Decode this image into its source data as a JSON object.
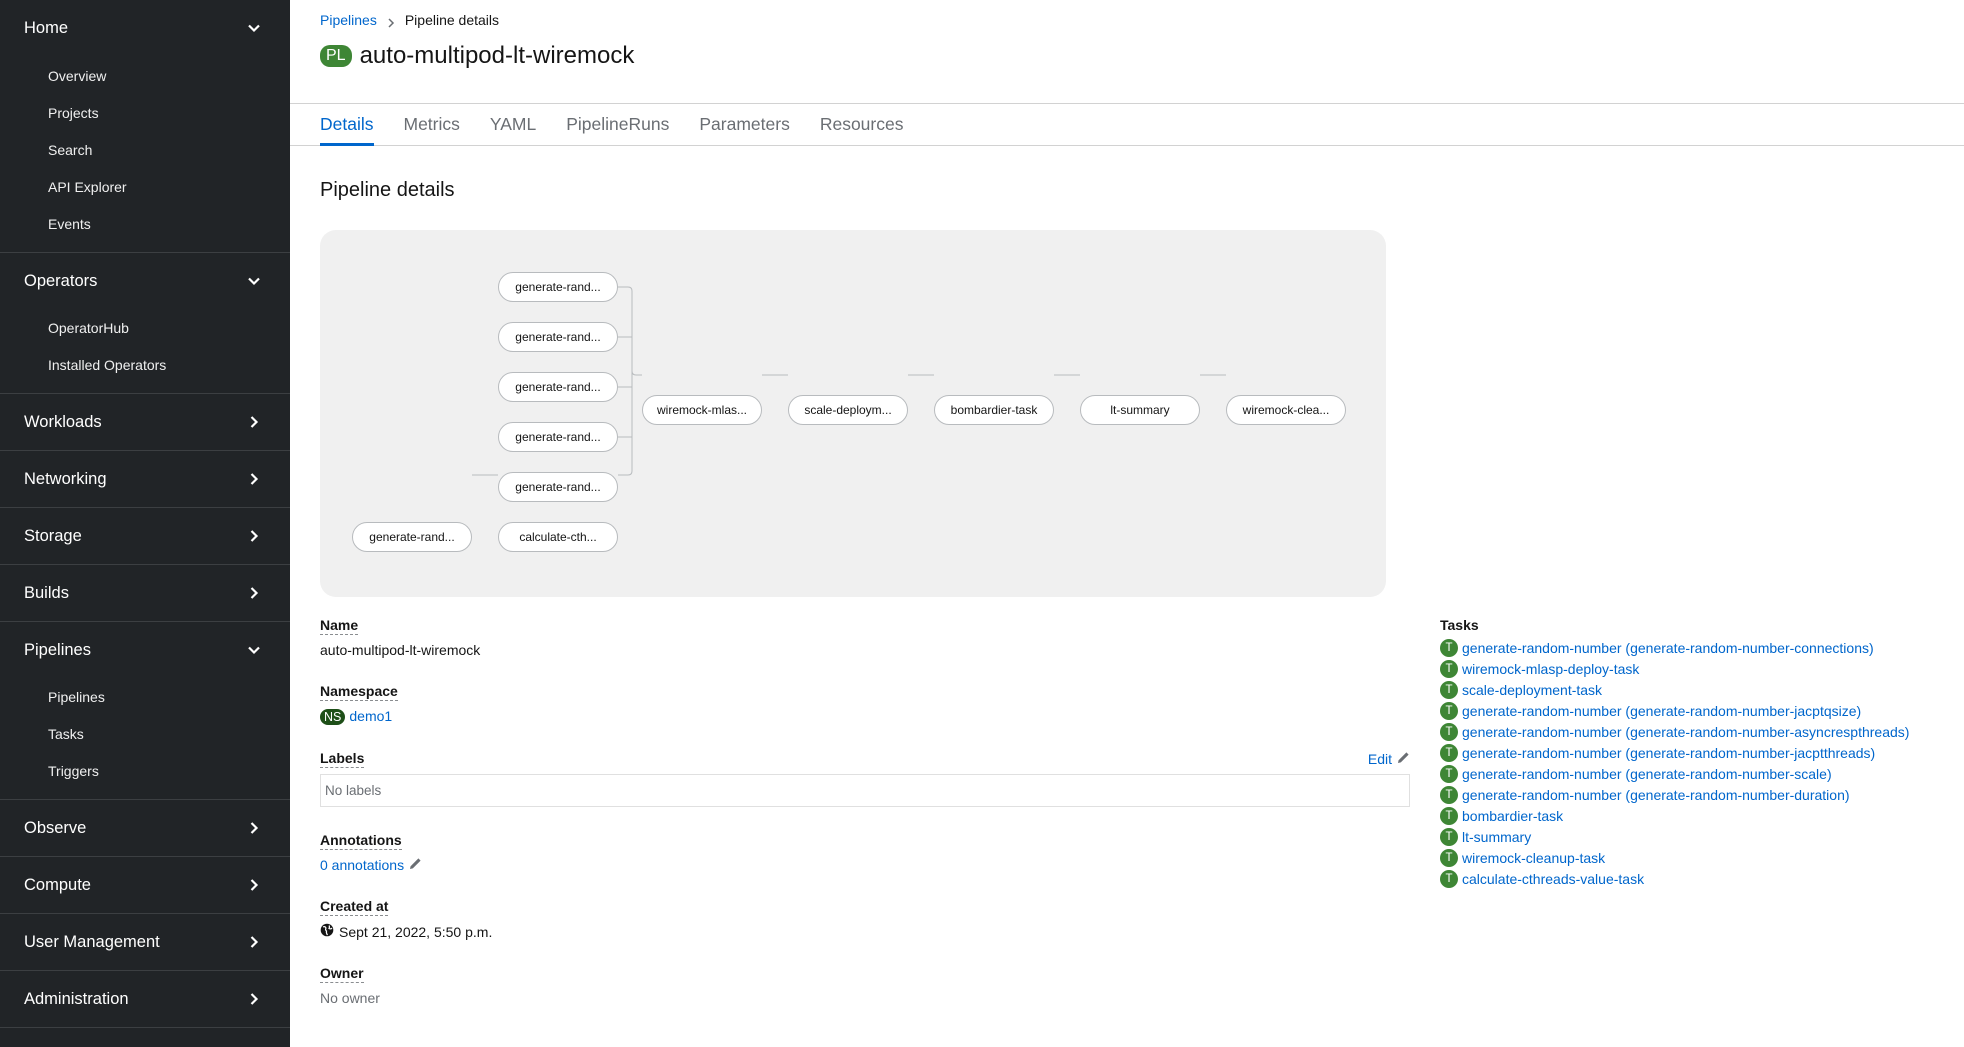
{
  "sidebar": {
    "home": {
      "label": "Home",
      "items": [
        "Overview",
        "Projects",
        "Search",
        "API Explorer",
        "Events"
      ]
    },
    "operators": {
      "label": "Operators",
      "items": [
        "OperatorHub",
        "Installed Operators"
      ]
    },
    "workloads": {
      "label": "Workloads"
    },
    "networking": {
      "label": "Networking"
    },
    "storage": {
      "label": "Storage"
    },
    "builds": {
      "label": "Builds"
    },
    "pipelines": {
      "label": "Pipelines",
      "items": [
        "Pipelines",
        "Tasks",
        "Triggers"
      ]
    },
    "observe": {
      "label": "Observe"
    },
    "compute": {
      "label": "Compute"
    },
    "user_management": {
      "label": "User Management"
    },
    "administration": {
      "label": "Administration"
    }
  },
  "breadcrumb": {
    "parent": "Pipelines",
    "current": "Pipeline details"
  },
  "header": {
    "badge": "PL",
    "title": "auto-multipod-lt-wiremock"
  },
  "tabs": [
    "Details",
    "Metrics",
    "YAML",
    "PipelineRuns",
    "Parameters",
    "Resources"
  ],
  "section_title": "Pipeline details",
  "graph": {
    "nodes": {
      "g1": "generate-rand...",
      "g2": "generate-rand...",
      "g3": "generate-rand...",
      "g4": "generate-rand...",
      "g5": "generate-rand...",
      "g6": "generate-rand...",
      "calc": "calculate-cth...",
      "wm": "wiremock-mlas...",
      "scale": "scale-deploym...",
      "bomb": "bombardier-task",
      "lt": "lt-summary",
      "clean": "wiremock-clea..."
    }
  },
  "details": {
    "name_label": "Name",
    "name_value": "auto-multipod-lt-wiremock",
    "namespace_label": "Namespace",
    "namespace_badge": "NS",
    "namespace_value": "demo1",
    "labels_label": "Labels",
    "labels_edit": "Edit",
    "labels_empty": "No labels",
    "annotations_label": "Annotations",
    "annotations_value": "0 annotations",
    "created_label": "Created at",
    "created_value": "Sept 21, 2022, 5:50 p.m.",
    "owner_label": "Owner",
    "owner_value": "No owner"
  },
  "tasks": {
    "title": "Tasks",
    "badge": "T",
    "items": [
      "generate-random-number (generate-random-number-connections)",
      "wiremock-mlasp-deploy-task",
      "scale-deployment-task",
      "generate-random-number (generate-random-number-jacptqsize)",
      "generate-random-number (generate-random-number-asyncrespthreads)",
      "generate-random-number (generate-random-number-jacptthreads)",
      "generate-random-number (generate-random-number-scale)",
      "generate-random-number (generate-random-number-duration)",
      "bombardier-task",
      "lt-summary",
      "wiremock-cleanup-task",
      "calculate-cthreads-value-task"
    ]
  }
}
